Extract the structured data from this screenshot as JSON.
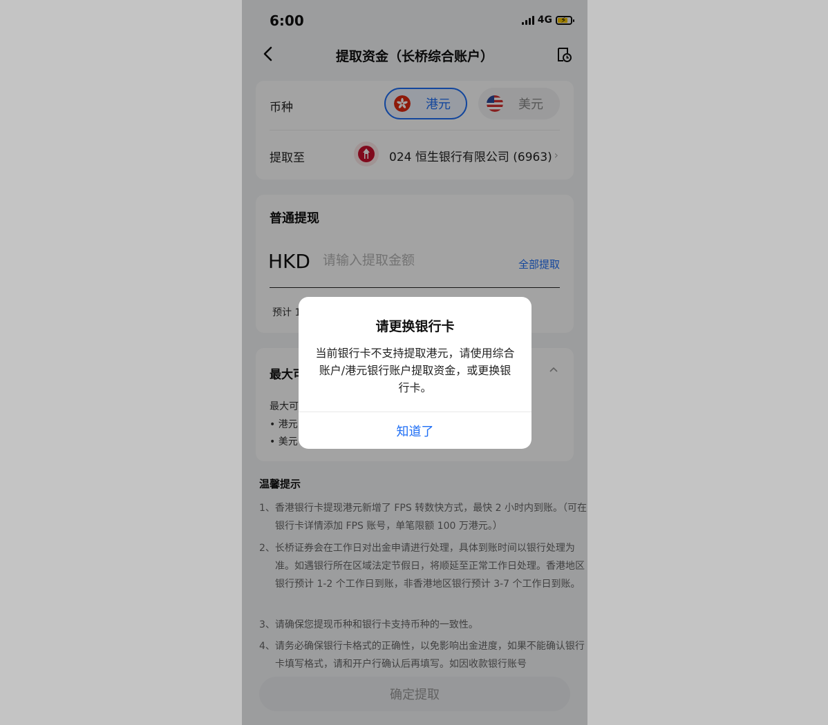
{
  "status_bar": {
    "time": "6:00",
    "network": "4G"
  },
  "nav": {
    "title": "提取资金（长桥综合账户）"
  },
  "currency_row": {
    "label": "币种",
    "options": [
      {
        "label": "港元",
        "flag": "hk-flag-icon",
        "selected": true
      },
      {
        "label": "美元",
        "flag": "us-flag-icon",
        "selected": false
      }
    ]
  },
  "withdraw_to": {
    "label": "提取至",
    "bank": "024 恒生银行有限公司 (6963)",
    "bank_icon": "hang-seng-logo-icon"
  },
  "normal_withdraw": {
    "title": "普通提现",
    "currency": "HKD",
    "input_placeholder": "请输入提取金额",
    "input_value": "",
    "withdraw_all": "全部提取",
    "estimate_text": "预计 1"
  },
  "max_section": {
    "title": "最大可",
    "subtitle": "最大可",
    "bullets": [
      "• 港元",
      "• 美元"
    ]
  },
  "tips": {
    "title": "温馨提示",
    "items": [
      "1、香港银行卡提现港元新增了 FPS 转数快方式，最快 2 小时内到账。（可在银行卡详情添加 FPS 账号，单笔限额 100 万港元。）",
      "2、长桥证券会在工作日对出金申请进行处理，具体到账时间以银行处理为准。如遇银行所在区域法定节假日，将顺延至正常工作日处理。香港地区银行预计 1-2 个工作日到账，非香港地区银行预计 3-7 个工作日到账。",
      "3、请确保您提现币种和银行卡支持币种的一致性。",
      "4、请务必确保银行卡格式的正确性，以免影响出金进度，如果不能确认银行卡填写格式，请和开户行确认后再填写。如因收款银行账号"
    ]
  },
  "confirm_button": "确定提取",
  "dialog": {
    "title": "请更换银行卡",
    "message": "当前银行卡不支持提取港元，请使用综合账户/港元银行账户提取资金，或更换银行卡。",
    "button": "知道了"
  },
  "colors": {
    "accent": "#1e6ef5",
    "overlay": "rgba(0,0,0,0.36)",
    "page_bg": "#c4c4c4"
  }
}
